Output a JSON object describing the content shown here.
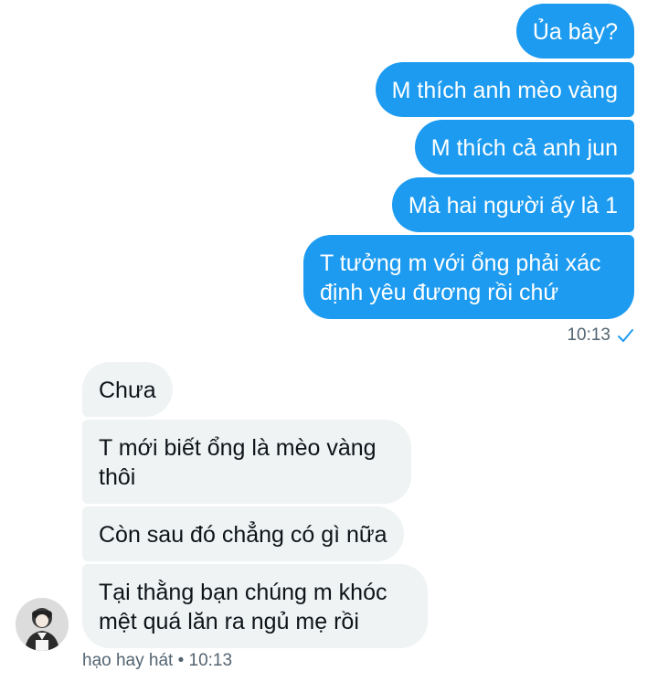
{
  "conversation": {
    "outgoing": [
      "Ủa bây?",
      "M thích anh mèo vàng",
      "M thích cả anh jun",
      "Mà hai người ấy là 1",
      "T tưởng m với ổng phải xác định yêu đương rồi chứ"
    ],
    "outgoing_time": "10:13",
    "incoming": [
      "Chưa",
      "T mới biết ổng là mèo vàng thôi",
      "Còn sau đó chẳng có gì nữa",
      "Tại thằng bạn chúng m khóc mệt quá lăn ra ngủ mẹ rồi"
    ],
    "incoming_meta": "hạo hay hát • 10:13"
  },
  "colors": {
    "outgoing_bubble": "#1d9bf0",
    "incoming_bubble": "#eff3f4",
    "read_check": "#1d9bf0"
  },
  "icons": {
    "read_receipt": "check-icon"
  }
}
